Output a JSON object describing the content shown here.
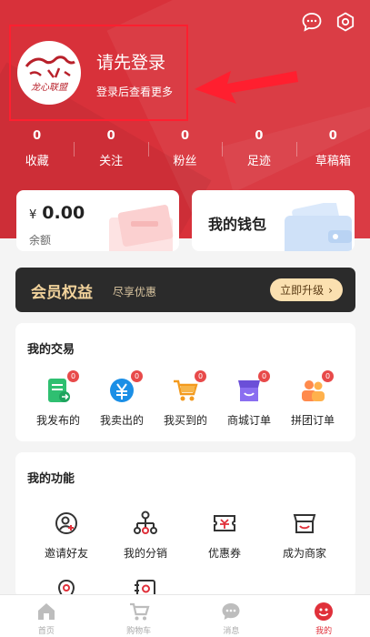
{
  "profile": {
    "title": "请先登录",
    "subtitle": "登录后查看更多",
    "avatar_text": "龙心联盟"
  },
  "stats": [
    {
      "value": "0",
      "label": "收藏"
    },
    {
      "value": "0",
      "label": "关注"
    },
    {
      "value": "0",
      "label": "粉丝"
    },
    {
      "value": "0",
      "label": "足迹"
    },
    {
      "value": "0",
      "label": "草稿箱"
    }
  ],
  "balance": {
    "currency": "¥",
    "amount": "0.00",
    "label": "余额"
  },
  "wallet": {
    "title": "我的钱包"
  },
  "vip": {
    "title": "会员权益",
    "subtitle": "尽享优惠",
    "button": "立即升级"
  },
  "trade": {
    "title": "我的交易",
    "items": [
      {
        "label": "我发布的",
        "badge": "0",
        "icon": "publish-icon"
      },
      {
        "label": "我卖出的",
        "badge": "0",
        "icon": "sold-yen-icon"
      },
      {
        "label": "我买到的",
        "badge": "0",
        "icon": "cart-icon"
      },
      {
        "label": "商城订单",
        "badge": "0",
        "icon": "store-icon"
      },
      {
        "label": "拼团订单",
        "badge": "0",
        "icon": "group-icon"
      }
    ]
  },
  "functions": {
    "title": "我的功能",
    "items": [
      {
        "label": "邀请好友",
        "icon": "invite-icon"
      },
      {
        "label": "我的分销",
        "icon": "distribution-icon"
      },
      {
        "label": "优惠券",
        "icon": "coupon-icon"
      },
      {
        "label": "成为商家",
        "icon": "merchant-icon"
      }
    ]
  },
  "tabs": [
    {
      "label": "首页",
      "icon": "home-icon"
    },
    {
      "label": "购物车",
      "icon": "cart-icon"
    },
    {
      "label": "消息",
      "icon": "message-icon"
    },
    {
      "label": "我的",
      "icon": "profile-icon",
      "active": true
    }
  ],
  "colors": {
    "brand": "#d8313a",
    "vip_bg": "#2b2b2b",
    "vip_gold": "#f1d29b",
    "badge": "#e84a4a"
  }
}
